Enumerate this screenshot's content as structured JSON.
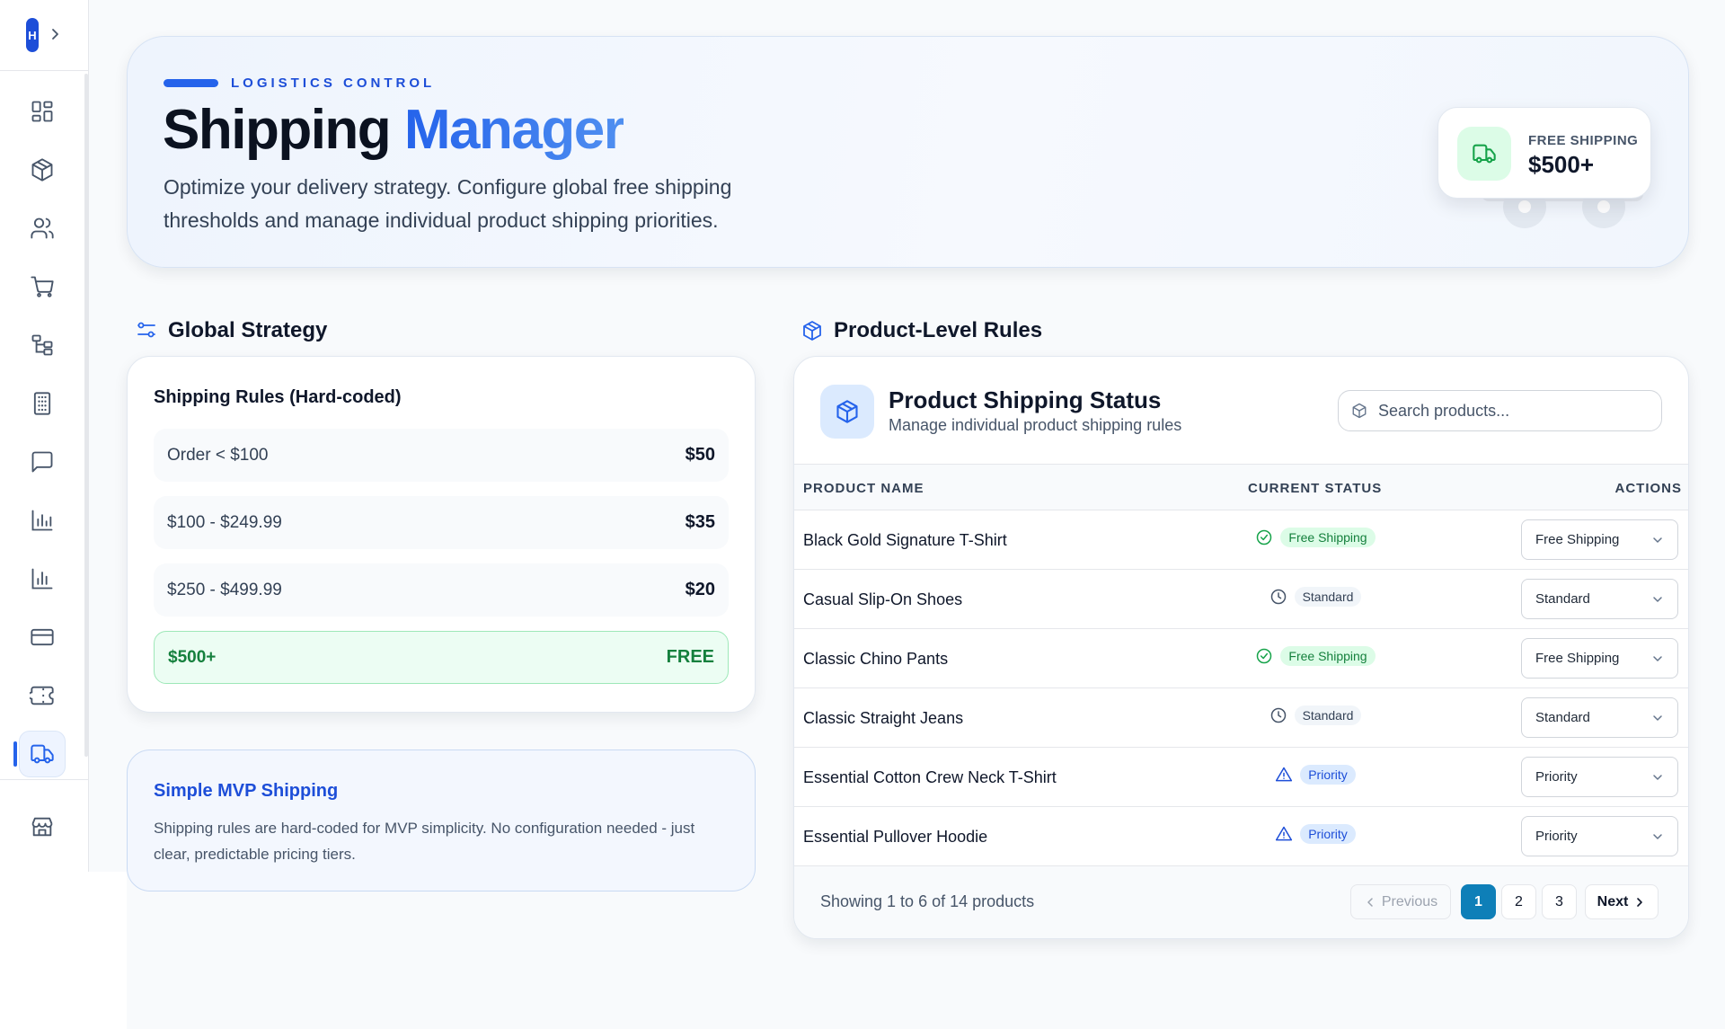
{
  "sidebar": {
    "logo_letter": "H",
    "items": [
      {
        "icon": "dashboard-icon"
      },
      {
        "icon": "package-icon"
      },
      {
        "icon": "users-icon"
      },
      {
        "icon": "cart-icon"
      },
      {
        "icon": "categories-icon"
      },
      {
        "icon": "building-icon"
      },
      {
        "icon": "message-icon"
      },
      {
        "icon": "bar-chart-icon"
      },
      {
        "icon": "analytics-icon"
      },
      {
        "icon": "credit-card-icon"
      },
      {
        "icon": "ticket-icon"
      },
      {
        "icon": "truck-icon",
        "active": true
      }
    ],
    "bottom_icon": "store-icon"
  },
  "hero": {
    "eyebrow": "LOGISTICS CONTROL",
    "title_main": "Shipping",
    "title_accent": "Manager",
    "subtitle": "Optimize your delivery strategy. Configure global free shipping thresholds and manage individual product shipping priorities.",
    "badge_label": "FREE SHIPPING",
    "badge_value": "$500+"
  },
  "global_strategy": {
    "heading": "Global Strategy",
    "card_title": "Shipping Rules (Hard-coded)",
    "rules": [
      {
        "range": "Order < $100",
        "price": "$50"
      },
      {
        "range": "$100 - $249.99",
        "price": "$35"
      },
      {
        "range": "$250 - $499.99",
        "price": "$20"
      },
      {
        "range": "$500+",
        "price": "FREE"
      }
    ],
    "info_title": "Simple MVP Shipping",
    "info_text": "Shipping rules are hard-coded for MVP simplicity. No configuration needed - just clear, predictable pricing tiers."
  },
  "product_rules": {
    "heading": "Product-Level Rules",
    "card_title": "Product Shipping Status",
    "card_subtitle": "Manage individual product shipping rules",
    "search_placeholder": "Search products...",
    "columns": [
      "PRODUCT NAME",
      "CURRENT STATUS",
      "ACTIONS"
    ],
    "rows": [
      {
        "name": "Black Gold Signature T-Shirt",
        "status": "Free Shipping",
        "action": "Free Shipping"
      },
      {
        "name": "Casual Slip-On Shoes",
        "status": "Standard",
        "action": "Standard"
      },
      {
        "name": "Classic Chino Pants",
        "status": "Free Shipping",
        "action": "Free Shipping"
      },
      {
        "name": "Classic Straight Jeans",
        "status": "Standard",
        "action": "Standard"
      },
      {
        "name": "Essential Cotton Crew Neck T-Shirt",
        "status": "Priority",
        "action": "Priority"
      },
      {
        "name": "Essential Pullover Hoodie",
        "status": "Priority",
        "action": "Priority"
      }
    ],
    "showing": "Showing 1 to 6 of 14 products",
    "pagination": {
      "previous": "Previous",
      "pages": [
        "1",
        "2",
        "3"
      ],
      "current_page": "1",
      "next": "Next"
    }
  },
  "colors": {
    "accent": "#2563eb",
    "free_green": "#15803d",
    "active_page": "#0e7fb8"
  }
}
